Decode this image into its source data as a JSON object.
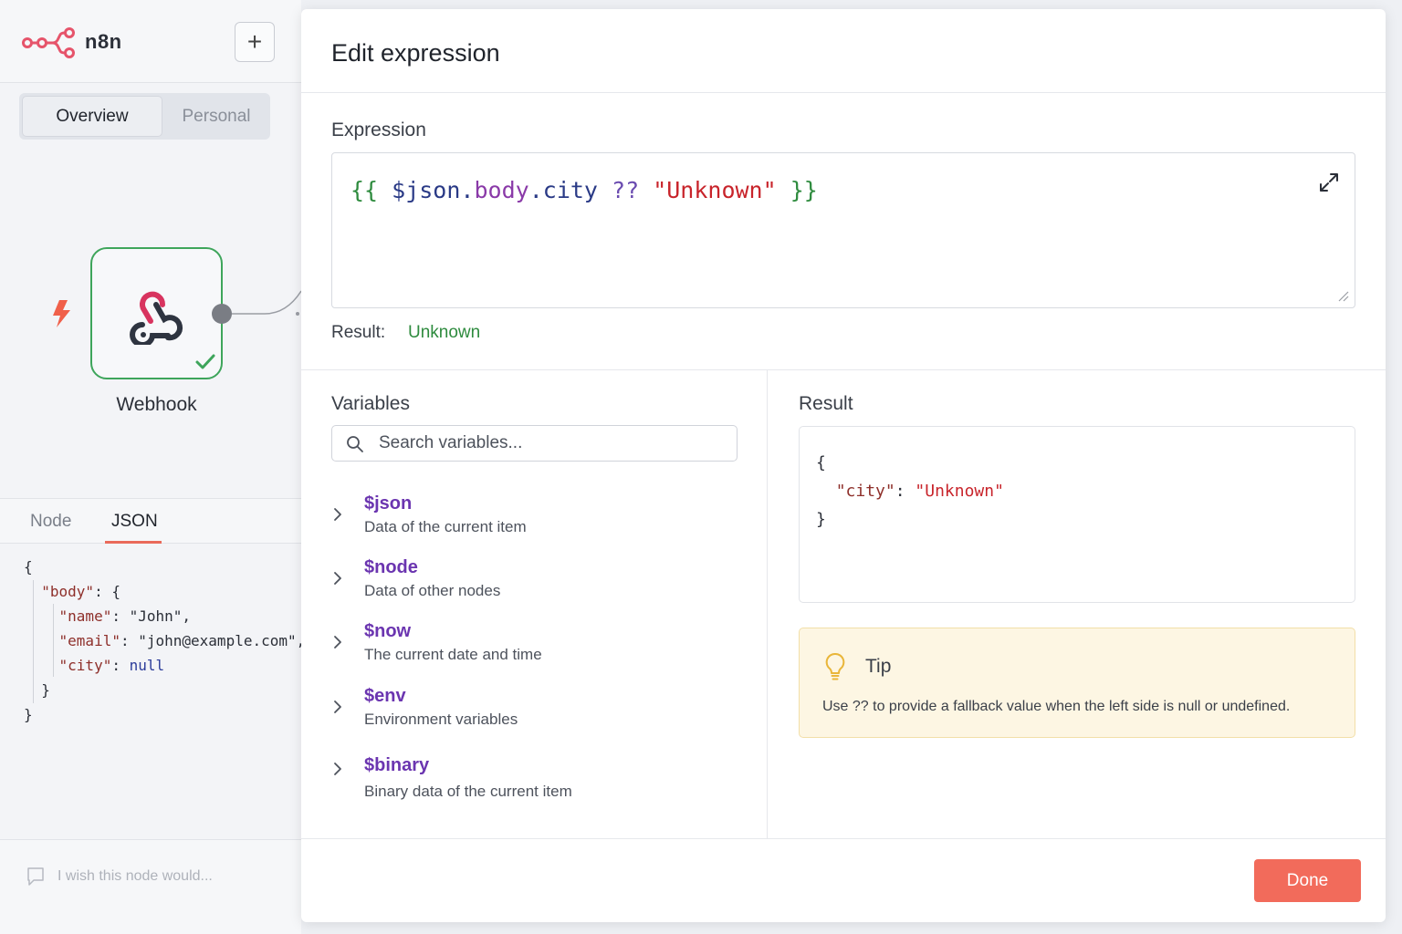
{
  "app": {
    "name": "n8n"
  },
  "sidebar": {
    "add_label": "+",
    "segments": [
      "Overview",
      "Personal"
    ],
    "node": {
      "label": "Webhook",
      "status": "success"
    },
    "tabs": [
      "Node",
      "JSON"
    ],
    "active_tab": "JSON",
    "json_lines": [
      {
        "text": "{"
      },
      {
        "key": "\"body\"",
        "rest": ": {"
      },
      {
        "key": "\"name\"",
        "sep": ": ",
        "val": "\"John\",",
        "vtype": "s"
      },
      {
        "key": "\"email\"",
        "sep": ": ",
        "val": "\"john@example.com\",",
        "vtype": "s"
      },
      {
        "key": "\"city\"",
        "sep": ": ",
        "val": "null",
        "vtype": "nl"
      },
      {
        "text": "}"
      },
      {
        "text": "}"
      }
    ],
    "feedback_placeholder": "I wish this node would..."
  },
  "modal": {
    "title": "Edit expression",
    "expression_label": "Expression",
    "expression_tokens": [
      {
        "t": "{{ ",
        "c": "br"
      },
      {
        "t": "$json",
        "c": "var"
      },
      {
        "t": ".",
        "c": "var"
      },
      {
        "t": "body",
        "c": "prop"
      },
      {
        "t": ".",
        "c": "var"
      },
      {
        "t": "city",
        "c": "var"
      },
      {
        "t": " ?? ",
        "c": "op"
      },
      {
        "t": "\"Unknown\"",
        "c": "str"
      },
      {
        "t": " }}",
        "c": "br"
      }
    ],
    "result_label": "Result:",
    "result_value": "Unknown",
    "variables": {
      "label": "Variables",
      "search_placeholder": "Search variables...",
      "items": [
        {
          "name": "$json",
          "desc": "Data of the current item"
        },
        {
          "name": "$node",
          "desc": "Data of other nodes"
        },
        {
          "name": "$now",
          "desc": "The current date and time"
        },
        {
          "name": "$env",
          "desc": "Environment variables"
        },
        {
          "name": "$binary",
          "desc": "Binary data of the current item"
        }
      ]
    },
    "result_panel": {
      "label": "Result",
      "lines": [
        {
          "text": "{"
        },
        {
          "key": "\"city\"",
          "sep": ": ",
          "val": "\"Unknown\""
        },
        {
          "text": "}"
        }
      ]
    },
    "tip": {
      "title": "Tip",
      "text": "Use ?? to provide a fallback value when the left side is null or undefined."
    },
    "done_label": "Done"
  },
  "colors": {
    "accent": "#f26b5b",
    "success": "#3ea55b",
    "variable": "#6b35b0",
    "string": "#c8242b",
    "tip_bg": "#fdf6e3"
  },
  "icons": [
    "n8n-logo-icon",
    "plus-icon",
    "lightning-icon",
    "webhook-icon",
    "check-icon",
    "feedback-icon",
    "expand-icon",
    "resize-icon",
    "search-icon",
    "chevron-right-icon",
    "lightbulb-icon"
  ]
}
